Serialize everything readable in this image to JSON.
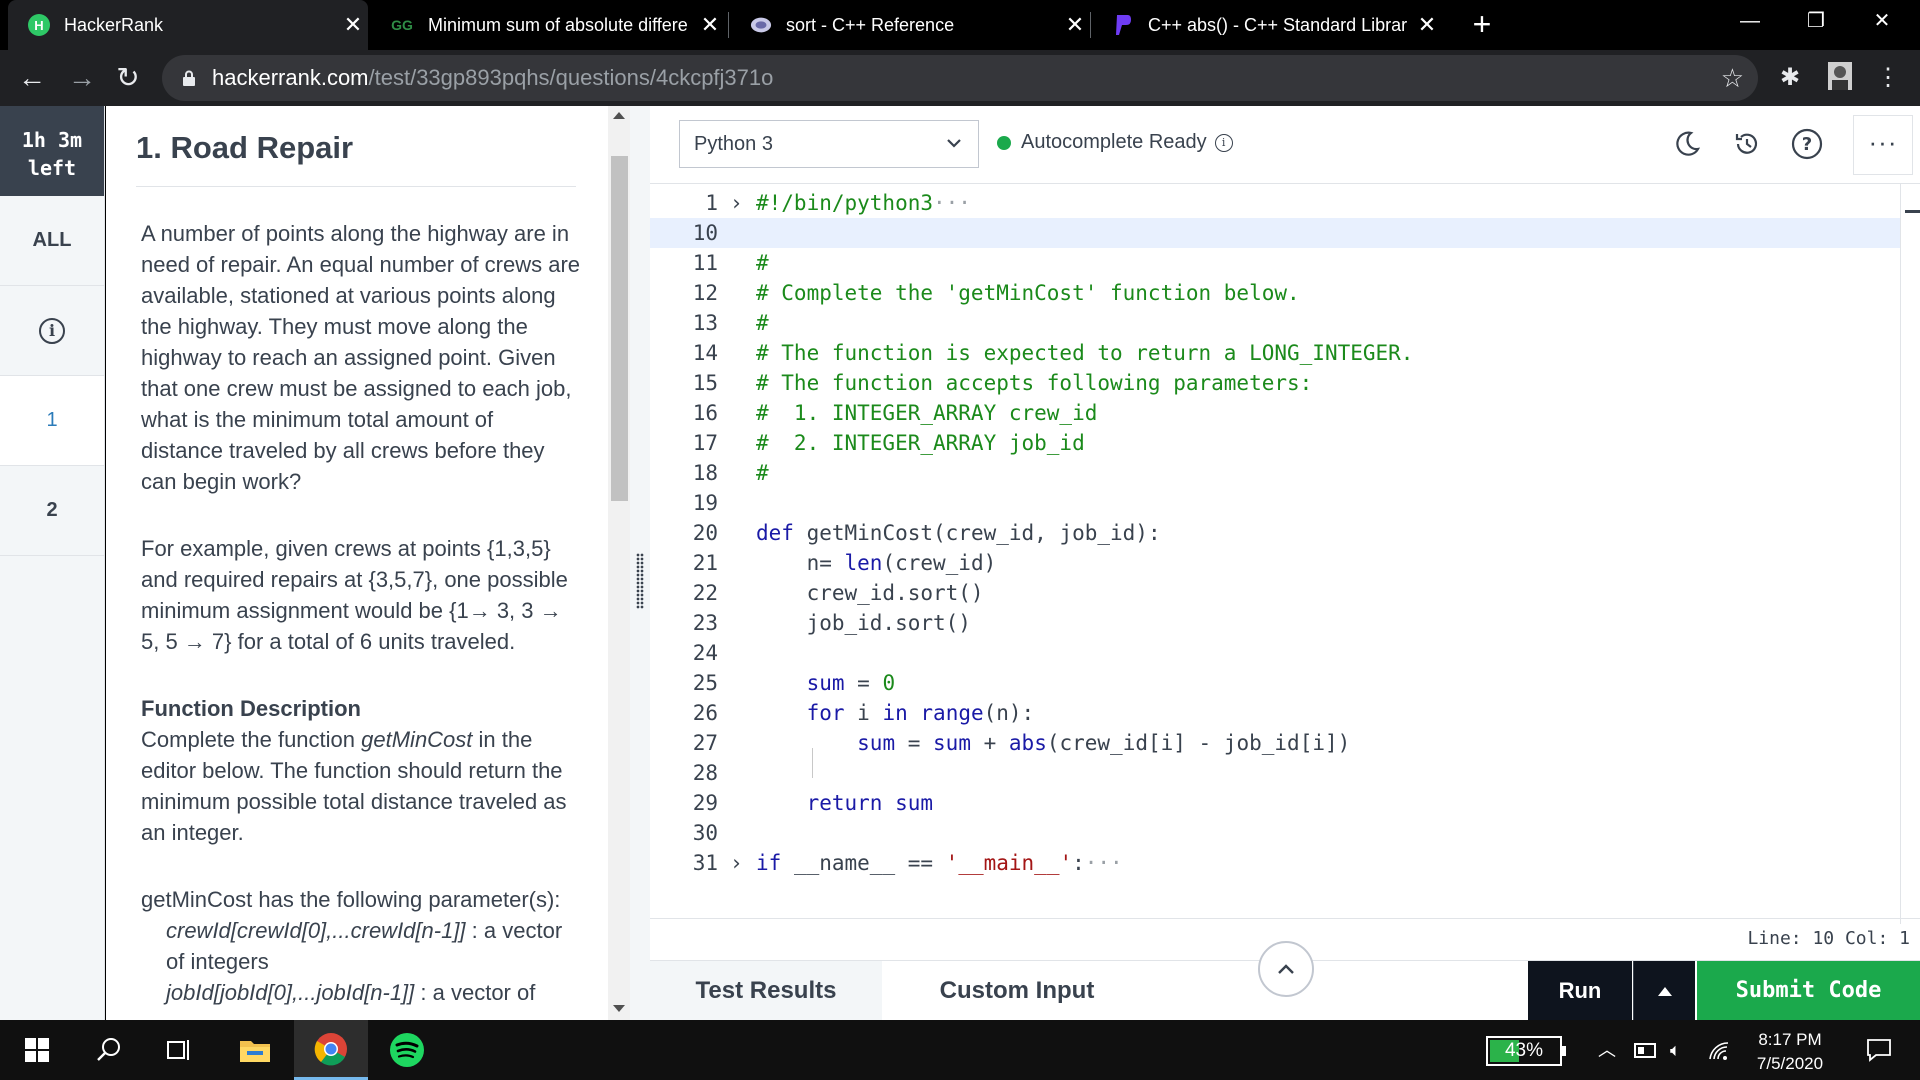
{
  "browser": {
    "tabs": [
      {
        "title": "HackerRank",
        "favicon": "hackerrank-icon",
        "active": true
      },
      {
        "title": "Minimum sum of absolute differe",
        "favicon": "geeksforgeeks-icon",
        "active": false
      },
      {
        "title": "sort - C++ Reference",
        "favicon": "cplusplus-icon",
        "active": false
      },
      {
        "title": "C++ abs() - C++ Standard Librar",
        "favicon": "programiz-icon",
        "active": false
      }
    ],
    "new_tab": "+",
    "url_host": "hackerrank.com",
    "url_path": "/test/33gp893pqhs/questions/4ckcpfj371o"
  },
  "leftnav": {
    "timer_line1": "1h 3m",
    "timer_line2": "left",
    "all_label": "ALL",
    "q1": "1",
    "q2": "2"
  },
  "problem": {
    "title": "1. Road Repair",
    "para1": "A number of points along the highway are in need of repair. An equal number of crews are available, stationed at various points along the highway. They must move along the highway to reach an assigned point. Given that one crew must be assigned to each job, what is the minimum total amount of distance traveled by all crews before they can begin work?",
    "para2": "For example, given crews at points {1,3,5} and required repairs at {3,5,7}, one possible minimum assignment would be {1→ 3, 3 → 5, 5 → 7} for a total of 6 units traveled.",
    "fd_heading": "Function Description",
    "fd_pre": "Complete the function ",
    "fd_fn": "getMinCost",
    "fd_post": " in the editor below. The function should return the minimum possible total distance traveled as an integer.",
    "params_intro": "getMinCost has the following parameter(s):",
    "param1_name": "crewId[crewId[0],...crewId[n-1]]",
    "param1_desc": " : a vector of integers",
    "param2_name": "jobId[jobId[0],...jobId[n-1]]",
    "param2_desc": " : a vector of"
  },
  "editor": {
    "language": "Python 3",
    "autocomplete": "Autocomplete Ready",
    "status": "Line: 10 Col: 1",
    "lines": [
      {
        "n": "1",
        "fold": "›",
        "text": "#!/bin/python3",
        "ellipsis": "···"
      },
      {
        "n": "10",
        "text": ""
      },
      {
        "n": "11",
        "text": "#"
      },
      {
        "n": "12",
        "text": "# Complete the 'getMinCost' function below."
      },
      {
        "n": "13",
        "text": "#"
      },
      {
        "n": "14",
        "text": "# The function is expected to return a LONG_INTEGER."
      },
      {
        "n": "15",
        "text": "# The function accepts following parameters:"
      },
      {
        "n": "16",
        "text": "#  1. INTEGER_ARRAY crew_id"
      },
      {
        "n": "17",
        "text": "#  2. INTEGER_ARRAY job_id"
      },
      {
        "n": "18",
        "text": "#"
      },
      {
        "n": "19",
        "text": ""
      },
      {
        "n": "20",
        "kw": "def",
        "text": " getMinCost(crew_id, job_id):"
      },
      {
        "n": "21",
        "pre": "    n= ",
        "kw": "len",
        "text": "(crew_id)"
      },
      {
        "n": "22",
        "text": "    crew_id.sort()"
      },
      {
        "n": "23",
        "text": "    job_id.sort()"
      },
      {
        "n": "24",
        "text": ""
      },
      {
        "n": "25",
        "pre": "    ",
        "kw": "sum",
        "mid": " = ",
        "num": "0"
      },
      {
        "n": "26",
        "pre": "    ",
        "kw": "for",
        "mid": " i ",
        "kw2": "in",
        "mid2": " ",
        "kw3": "range",
        "text": "(n):"
      },
      {
        "n": "27",
        "pre": "        ",
        "kw": "sum",
        "mid": " = ",
        "kw2": "sum",
        "mid2": " + ",
        "kw3": "abs",
        "text": "(crew_id[i] - job_id[i])"
      },
      {
        "n": "28",
        "text": ""
      },
      {
        "n": "29",
        "pre": "    ",
        "kw": "return",
        "mid": " ",
        "kw2": "sum"
      },
      {
        "n": "30",
        "text": ""
      },
      {
        "n": "31",
        "fold": "›",
        "kw": "if",
        "text": " __name__ == ",
        "str": "'__main__'",
        "post": ":",
        "ellipsis": "···"
      }
    ]
  },
  "actions": {
    "test_results": "Test Results",
    "custom_input": "Custom Input",
    "run": "Run",
    "submit": "Submit Code"
  },
  "taskbar": {
    "battery_pct": "43%",
    "battery_level": 0.43,
    "time": "8:17 PM",
    "date": "7/5/2020"
  },
  "colors": {
    "accent_green": "#1ba94c",
    "dark": "#0e141e",
    "timer_bg": "#39424e"
  }
}
